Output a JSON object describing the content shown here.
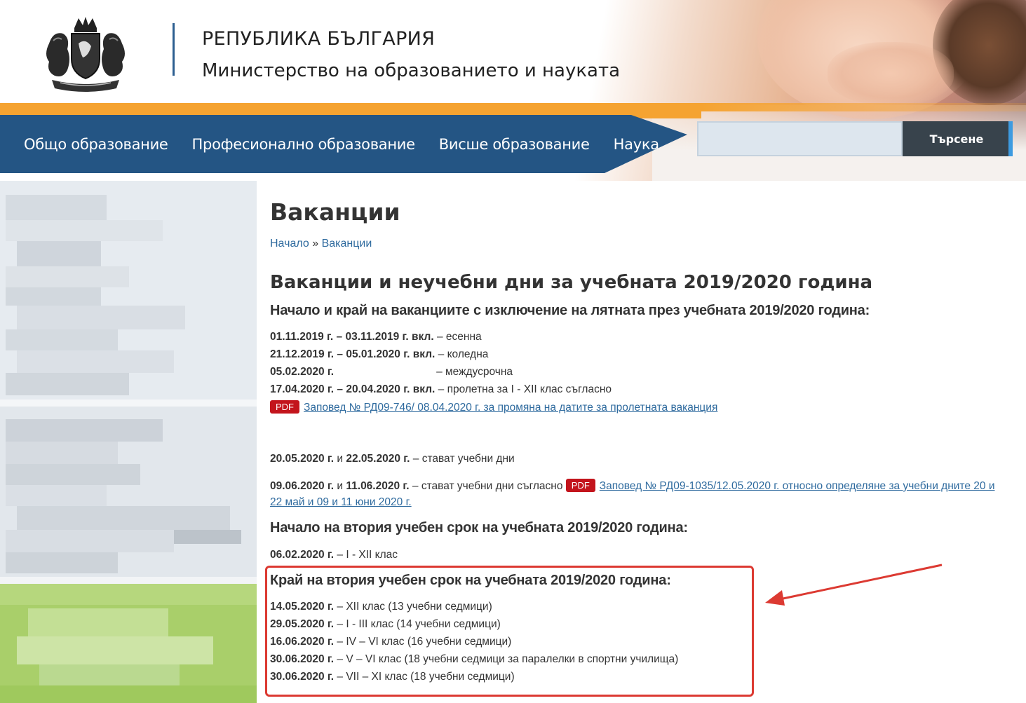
{
  "header": {
    "country": "РЕПУБЛИКА БЪЛГАРИЯ",
    "ministry": "Министерство на образованието и науката"
  },
  "nav": {
    "items": [
      {
        "label": "Общо образование"
      },
      {
        "label": "Професионално образование"
      },
      {
        "label": "Висше образование"
      },
      {
        "label": "Наука"
      }
    ]
  },
  "search": {
    "value": "",
    "button_label": "Търсене"
  },
  "page": {
    "title": "Ваканции",
    "breadcrumb": {
      "home": "Начало",
      "separator": "»",
      "current": "Ваканции"
    },
    "section_title": "Ваканции и неучебни дни за учебната 2019/2020 година",
    "block1": {
      "heading": "Начало и край на ваканциите с изключение на лятната през учебната 2019/2020 година:",
      "rows": [
        {
          "date": "01.11.2019 г. – 03.11.2019 г. вкл.",
          "text": " – есенна"
        },
        {
          "date": "21.12.2019 г. – 05.01.2020 г. вкл.",
          "text": " – коледна"
        },
        {
          "date": "05.02.2020 г.",
          "text": "– междусрочна"
        },
        {
          "date": "17.04.2020 г. – 20.04.2020 г. вкл.",
          "text": " – пролетна за I - XII клас съгласно"
        }
      ],
      "pdf_label": "PDF",
      "order_link": "Заповед № РД09-746/ 08.04.2020 г. за промяна на датите за пролетната ваканция"
    },
    "study_days": {
      "row1_date_a": "20.05.2020 г.",
      "row1_and": " и ",
      "row1_date_b": "22.05.2020 г.",
      "row1_text": " – стават учебни дни",
      "row2_date_a": "09.06.2020 г.",
      "row2_and": " и ",
      "row2_date_b": "11.06.2020 г.",
      "row2_text": " – стават учебни дни  съгласно ",
      "pdf_label": "PDF",
      "order_link_line1": "Заповед № РД09-1035/12.05.2020 г. относно определяне за учебни дните 20 и",
      "order_link_line2": "22 май и 09 и 11 юни 2020 г."
    },
    "block2": {
      "heading": "Начало на втория учебен срок на учебната 2019/2020 година:",
      "date": "06.02.2020 г.",
      "text": " – I - XII клас"
    },
    "block3": {
      "heading": "Край на втория учебен срок на учебната 2019/2020 година:",
      "rows": [
        {
          "date": "14.05.2020 г.",
          "text": " – XII клас (13 учебни седмици)"
        },
        {
          "date": "29.05.2020 г.",
          "text": " – I - III клас (14 учебни седмици)"
        },
        {
          "date": "16.06.2020 г.",
          "text": " – IV – VI клас (16 учебни седмици)"
        },
        {
          "date": "30.06.2020 г.",
          "text": " – V – VI клас (18 учебни седмици за паралелки в спортни училища)"
        },
        {
          "date": "30.06.2020 г.",
          "text": " – VII – XI клас (18 учебни седмици)"
        }
      ]
    }
  },
  "colors": {
    "nav_blue": "#245584",
    "orange": "#f5a331",
    "link": "#2e6a9e",
    "pdf_red": "#c3141c",
    "highlight": "#dc3a32"
  }
}
